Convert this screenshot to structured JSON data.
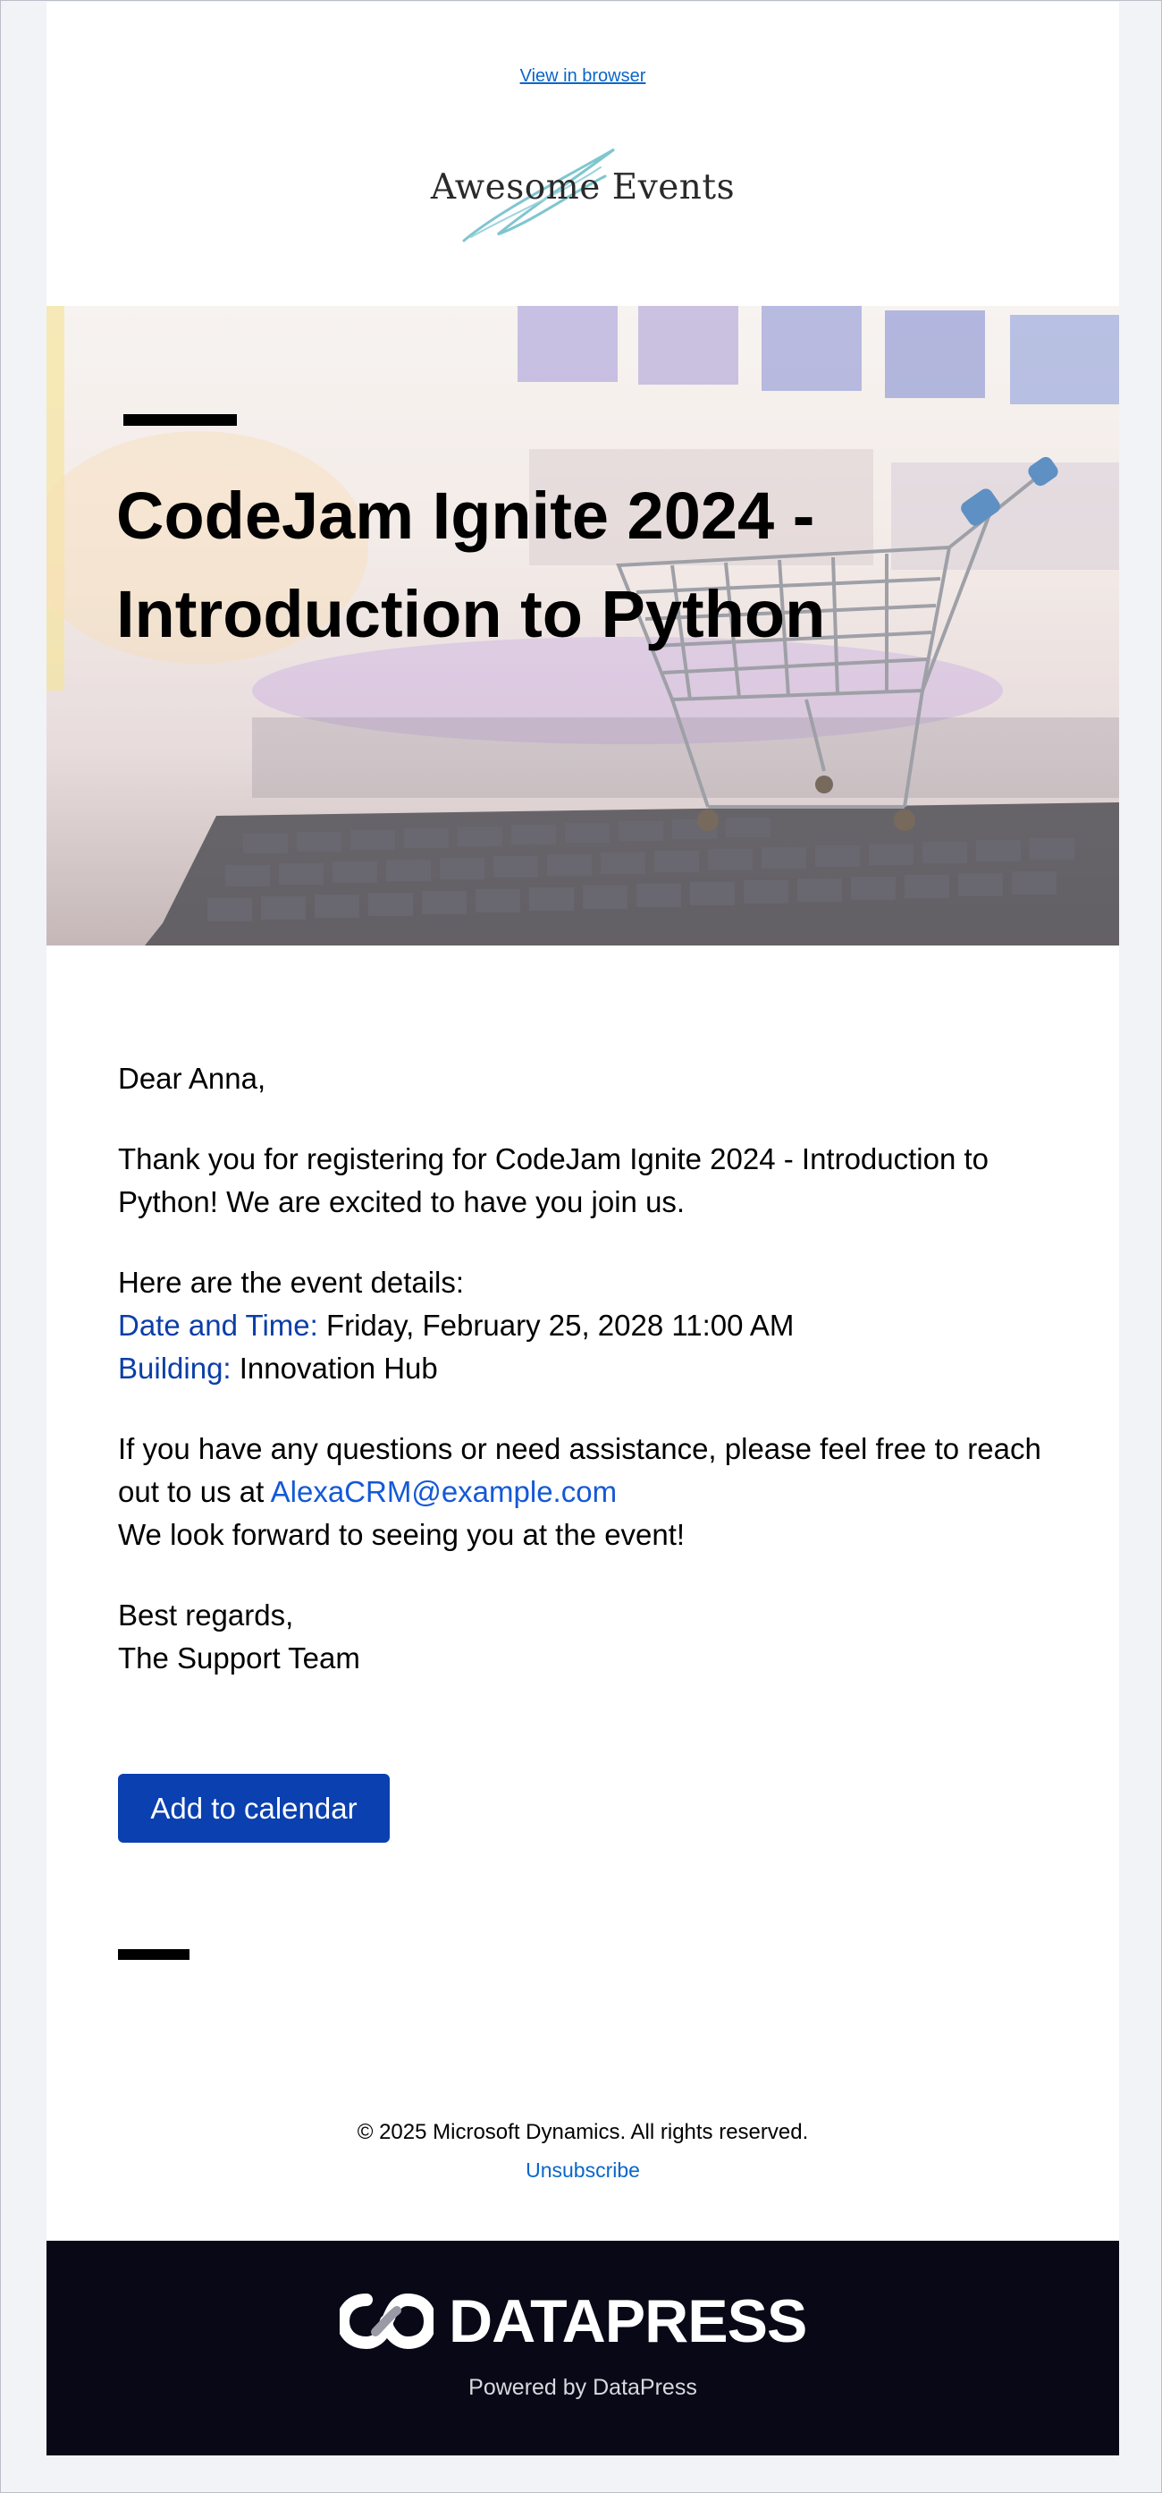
{
  "header": {
    "view_in_browser": "View in browser",
    "logo_text": "Awesome Events"
  },
  "hero": {
    "title_line1": "CodeJam Ignite 2024 -",
    "title_line2": "Introduction to Python"
  },
  "body": {
    "greeting": "Dear Anna,",
    "thanks": "Thank you for registering for CodeJam Ignite 2024 - Introduction to Python! We are excited to have you join us.",
    "details_intro": "Here are the event details:",
    "date_label": "Date and Time:",
    "date_value": " Friday, February 25, 2028 11:00 AM",
    "building_label": "Building:",
    "building_value": " Innovation Hub",
    "questions": "If you have any questions or need assistance, please feel free to reach out to us at ",
    "contact_email": "AlexaCRM@example.com",
    "look_forward": "We look forward to seeing you at the event!",
    "regards": "Best regards,",
    "team": "The Support Team"
  },
  "cta": {
    "add_to_calendar": "Add to calendar"
  },
  "footer": {
    "copyright": "© 2025 Microsoft Dynamics. All rights reserved.",
    "unsubscribe": "Unsubscribe",
    "brand": "DATAPRESS",
    "powered_by": "Powered by DataPress"
  },
  "colors": {
    "accent_blue": "#0a40b0",
    "link_blue": "#0a66c8",
    "footer_bg": "#080817"
  }
}
